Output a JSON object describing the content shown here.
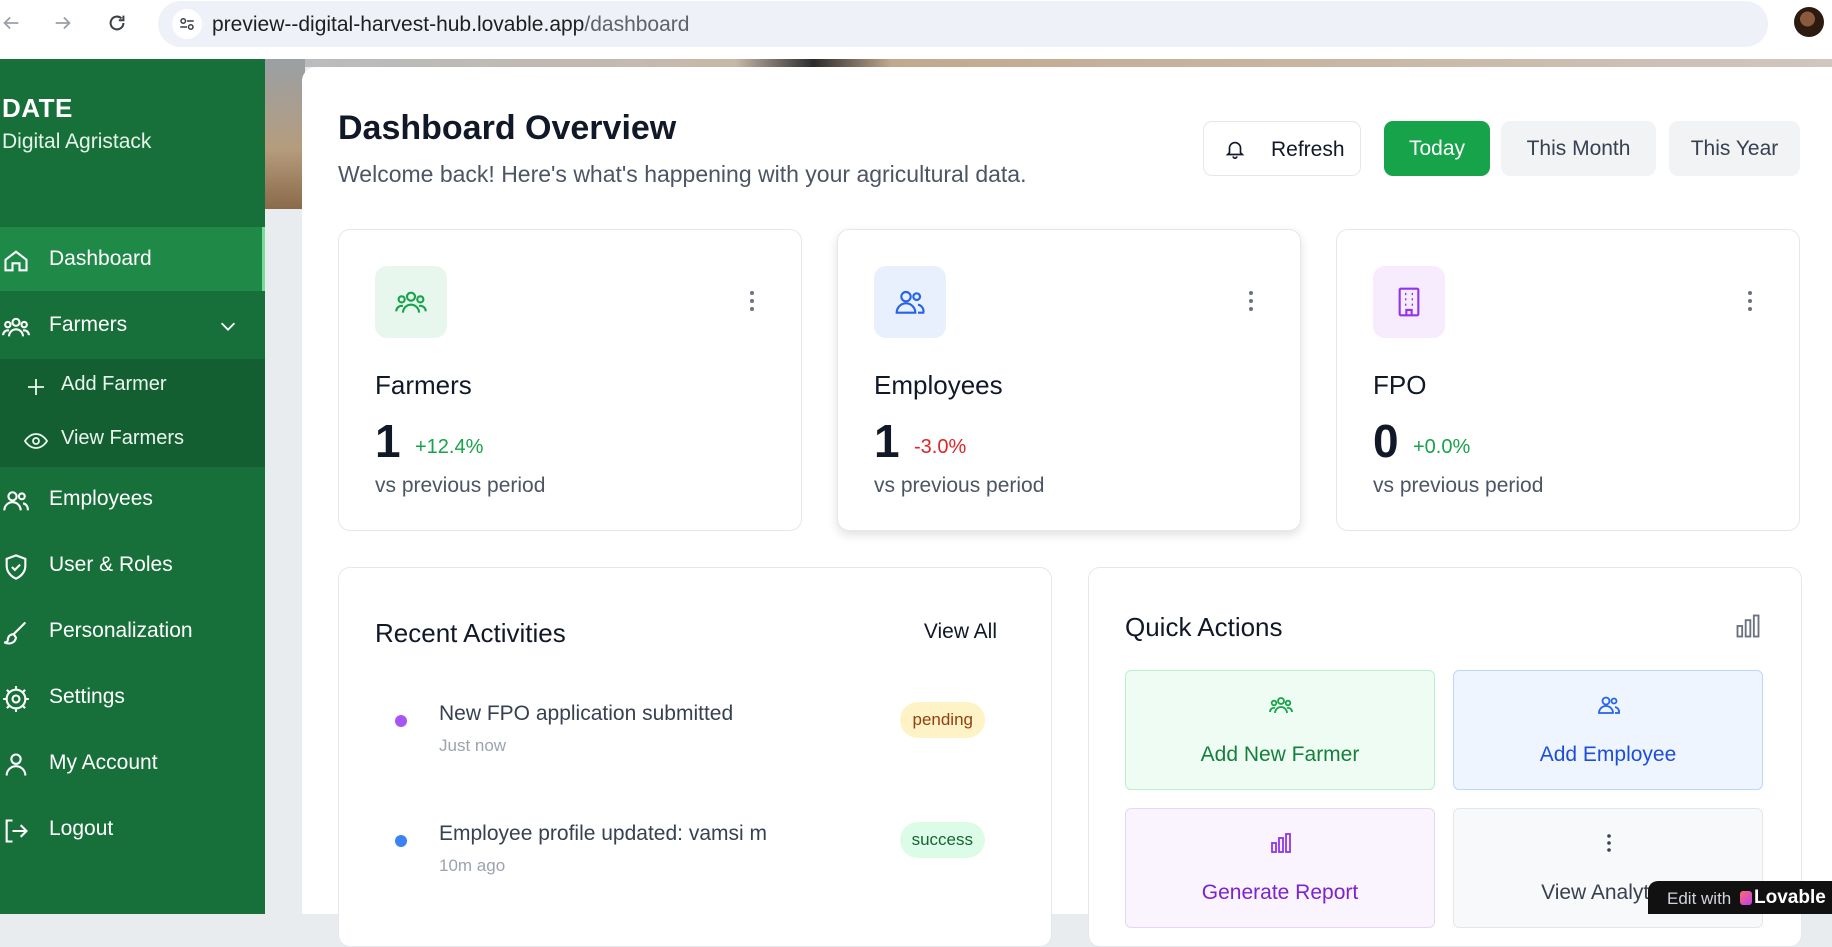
{
  "browser": {
    "url_host": "preview--digital-harvest-hub.lovable.app",
    "url_path": "/dashboard"
  },
  "sidebar": {
    "brand_title": "DATE",
    "brand_subtitle": "Digital Agristack",
    "items": [
      {
        "label": "Dashboard",
        "icon": "home-icon"
      },
      {
        "label": "Farmers",
        "icon": "users-icon"
      },
      {
        "label": "Employees",
        "icon": "user-group-icon"
      },
      {
        "label": "User & Roles",
        "icon": "shield-icon"
      },
      {
        "label": "Personalization",
        "icon": "brush-icon"
      },
      {
        "label": "Settings",
        "icon": "gear-icon"
      },
      {
        "label": "My Account",
        "icon": "user-icon"
      },
      {
        "label": "Logout",
        "icon": "logout-icon"
      }
    ],
    "farmers_submenu": [
      {
        "label": "Add Farmer",
        "icon": "plus-icon"
      },
      {
        "label": "View Farmers",
        "icon": "eye-icon"
      }
    ]
  },
  "header": {
    "title": "Dashboard Overview",
    "subtitle": "Welcome back! Here's what's happening with your agricultural data.",
    "refresh_label": "Refresh",
    "periods": [
      "Today",
      "This Month",
      "This Year"
    ],
    "active_period": "Today"
  },
  "stats": [
    {
      "title": "Farmers",
      "value": "1",
      "change": "+12.4%",
      "comparison": "vs previous period",
      "trend": "up"
    },
    {
      "title": "Employees",
      "value": "1",
      "change": "-3.0%",
      "comparison": "vs previous period",
      "trend": "down"
    },
    {
      "title": "FPO",
      "value": "0",
      "change": "+0.0%",
      "comparison": "vs previous period",
      "trend": "up"
    }
  ],
  "activities": {
    "title": "Recent Activities",
    "view_all": "View All",
    "items": [
      {
        "message": "New FPO application submitted",
        "time": "Just now",
        "status": "pending"
      },
      {
        "message": "Employee profile updated: vamsi m",
        "time": "10m ago",
        "status": "success"
      }
    ]
  },
  "quick_actions": {
    "title": "Quick Actions",
    "items": [
      {
        "label": "Add New Farmer"
      },
      {
        "label": "Add Employee"
      },
      {
        "label": "Generate Report"
      },
      {
        "label": "View Analytics"
      }
    ]
  },
  "badge": {
    "prefix": "Edit with",
    "brand": "Lovable"
  },
  "colors": {
    "sidebar": "#17703a",
    "primary": "#16a34a",
    "positive": "#16a34a",
    "negative": "#dc2626"
  }
}
